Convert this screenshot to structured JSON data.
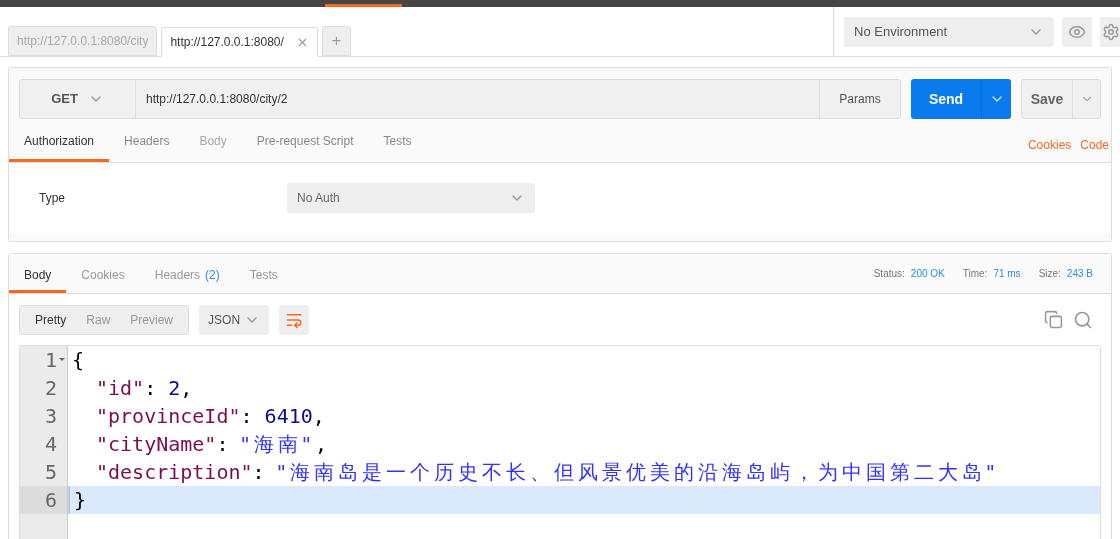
{
  "tabs": [
    {
      "label": "http://127.0.0.1:8080/city",
      "selected": false
    },
    {
      "label": "http://127.0.0.1:8080/",
      "selected": true
    }
  ],
  "new_tab": "+",
  "environment": {
    "value": "No Environment"
  },
  "request": {
    "method": "GET",
    "url": "http://127.0.0.1:8080/city/2",
    "params": "Params",
    "send": "Send",
    "save": "Save",
    "tabs": [
      {
        "label": "Authorization",
        "selected": true,
        "disabled": false
      },
      {
        "label": "Headers",
        "selected": false,
        "disabled": false
      },
      {
        "label": "Body",
        "selected": false,
        "disabled": true
      },
      {
        "label": "Pre-request Script",
        "selected": false,
        "disabled": false
      },
      {
        "label": "Tests",
        "selected": false,
        "disabled": false
      }
    ],
    "links": [
      "Cookies",
      "Code"
    ],
    "auth": {
      "label": "Type",
      "value": "No Auth"
    }
  },
  "response": {
    "tabs": [
      {
        "label": "Body",
        "selected": true
      },
      {
        "label": "Cookies",
        "selected": false
      },
      {
        "label": "Headers",
        "count": "(2)",
        "selected": false
      },
      {
        "label": "Tests",
        "selected": false
      }
    ],
    "stats": [
      {
        "label": "Status:",
        "value": "200 OK"
      },
      {
        "label": "Time:",
        "value": "71 ms"
      },
      {
        "label": "Size:",
        "value": "243 B"
      }
    ],
    "views": [
      {
        "label": "Pretty",
        "selected": true
      },
      {
        "label": "Raw",
        "selected": false
      },
      {
        "label": "Preview",
        "selected": false
      }
    ],
    "format": "JSON",
    "lines": [
      {
        "number": "1",
        "current": false,
        "foldable": true,
        "tokens": [
          {
            "kind": "punct",
            "text": "{"
          }
        ]
      },
      {
        "number": "2",
        "current": false,
        "foldable": false,
        "tokens": [
          {
            "kind": "key",
            "text": "\"id\""
          },
          {
            "kind": "punct",
            "text": ": "
          },
          {
            "kind": "number",
            "text": "2"
          },
          {
            "kind": "punct",
            "text": ","
          }
        ]
      },
      {
        "number": "3",
        "current": false,
        "foldable": false,
        "tokens": [
          {
            "kind": "key",
            "text": "\"provinceId\""
          },
          {
            "kind": "punct",
            "text": ": "
          },
          {
            "kind": "number",
            "text": "6410"
          },
          {
            "kind": "punct",
            "text": ","
          }
        ]
      },
      {
        "number": "4",
        "current": false,
        "foldable": false,
        "tokens": [
          {
            "kind": "key",
            "text": "\"cityName\""
          },
          {
            "kind": "punct",
            "text": ": "
          },
          {
            "kind": "string",
            "text": "\"海南\""
          },
          {
            "kind": "punct",
            "text": ","
          }
        ]
      },
      {
        "number": "5",
        "current": false,
        "foldable": false,
        "tokens": [
          {
            "kind": "key",
            "text": "\"description\""
          },
          {
            "kind": "punct",
            "text": ": "
          },
          {
            "kind": "string",
            "text": "\"海南岛是一个历史不长、但风景优美的沿海岛屿，为中国第二大岛\""
          }
        ]
      },
      {
        "number": "6",
        "current": true,
        "foldable": false,
        "tokens": [
          {
            "kind": "punct",
            "text": "}"
          }
        ]
      }
    ]
  }
}
